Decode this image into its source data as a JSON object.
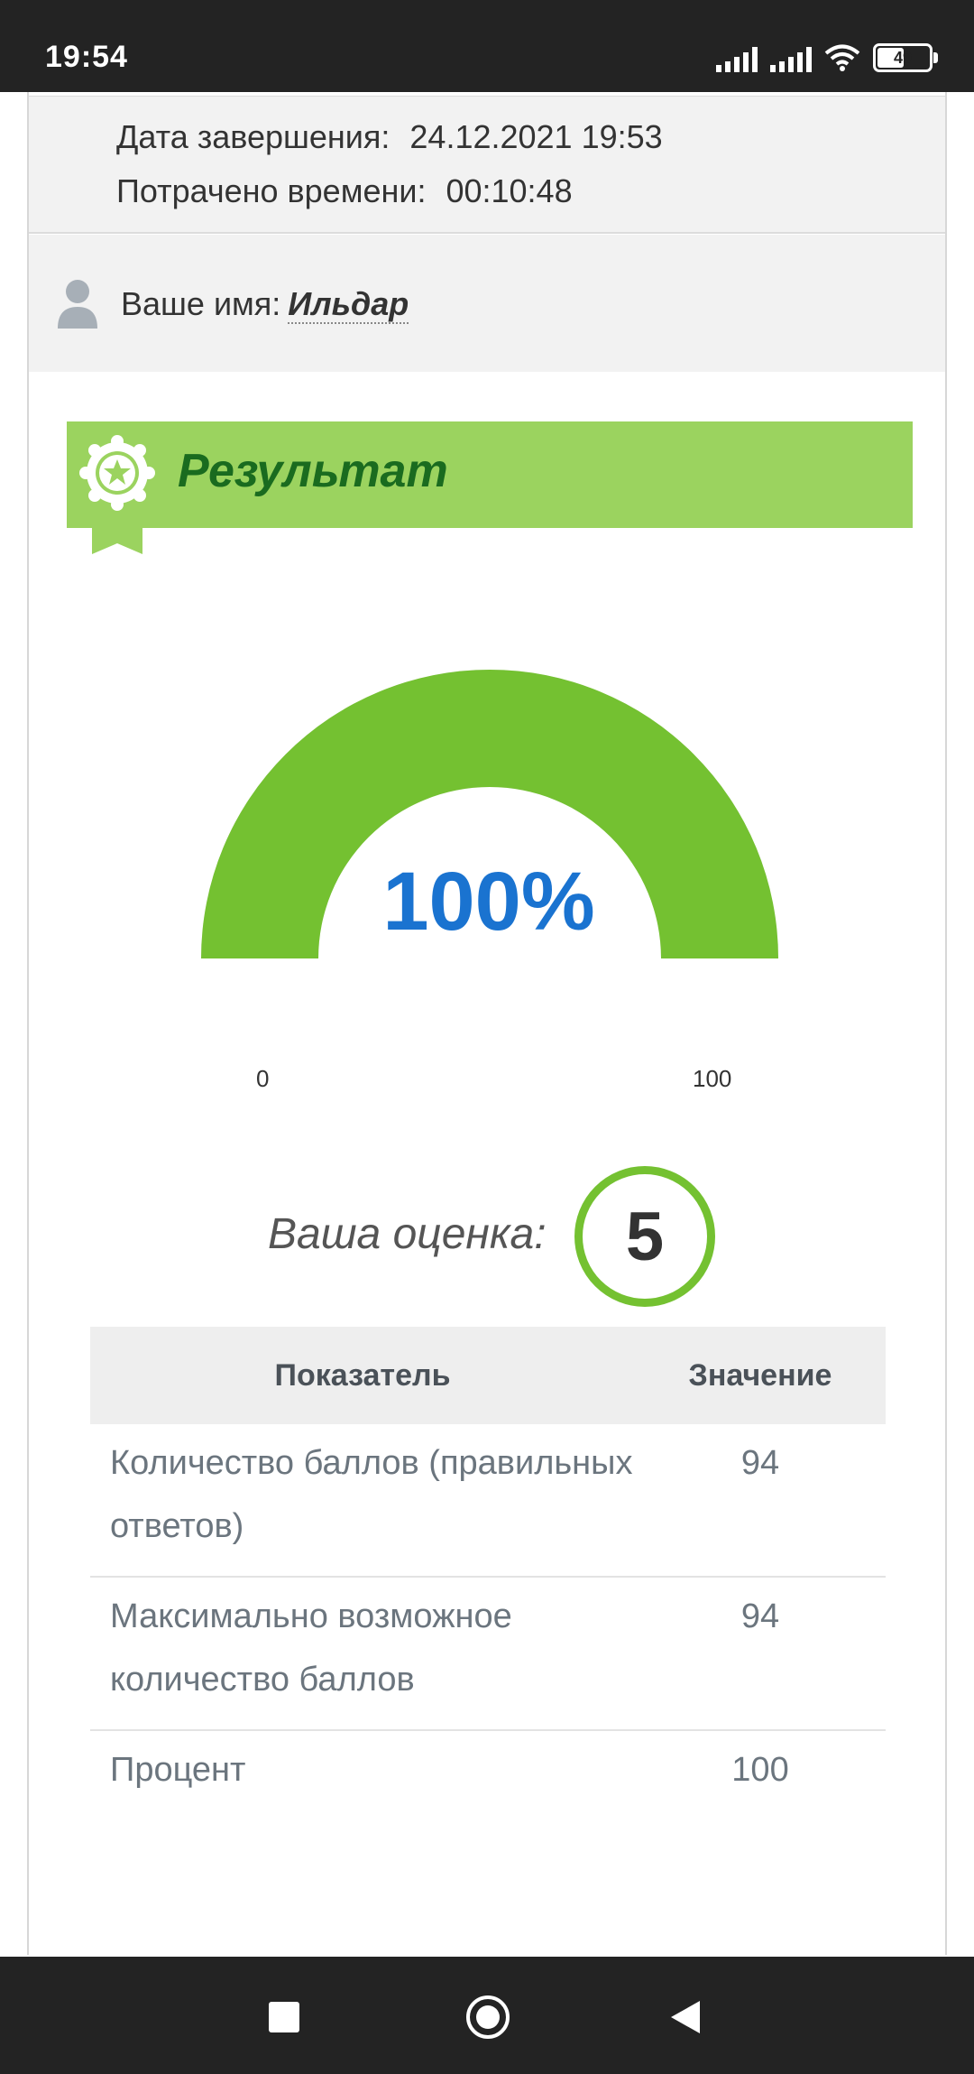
{
  "status_bar": {
    "time": "19:54",
    "battery_level": "49",
    "icons": [
      "signal-icon",
      "signal-icon",
      "wifi-icon",
      "battery-icon"
    ]
  },
  "info": {
    "completion_date_label": "Дата завершения:",
    "completion_date_value": "24.12.2021 19:53",
    "time_spent_label": "Потрачено времени:",
    "time_spent_value": "00:10:48"
  },
  "user": {
    "name_label": "Ваше имя:",
    "name_value": "Ильдар"
  },
  "result": {
    "title": "Результат",
    "gauge": {
      "value_text": "100%",
      "value": 100,
      "min_label": "0",
      "max_label": "100",
      "min": 0,
      "max": 100,
      "fill_color": "#74c131",
      "value_color": "#1a73d0"
    },
    "grade_label": "Ваша оценка:",
    "grade_value": "5"
  },
  "table": {
    "headers": [
      "Показатель",
      "Значение"
    ],
    "rows": [
      {
        "indicator": "Количество баллов (правильных ответов)",
        "value": "94"
      },
      {
        "indicator": "Максимально возможное количество баллов",
        "value": "94"
      },
      {
        "indicator": "Процент",
        "value": "100"
      }
    ]
  },
  "colors": {
    "banner": "#9bd35f",
    "banner_title": "#1a6b1f",
    "accent_green": "#74c131"
  },
  "nav_bar": {
    "buttons": [
      "recents-button",
      "home-button",
      "back-button"
    ]
  }
}
